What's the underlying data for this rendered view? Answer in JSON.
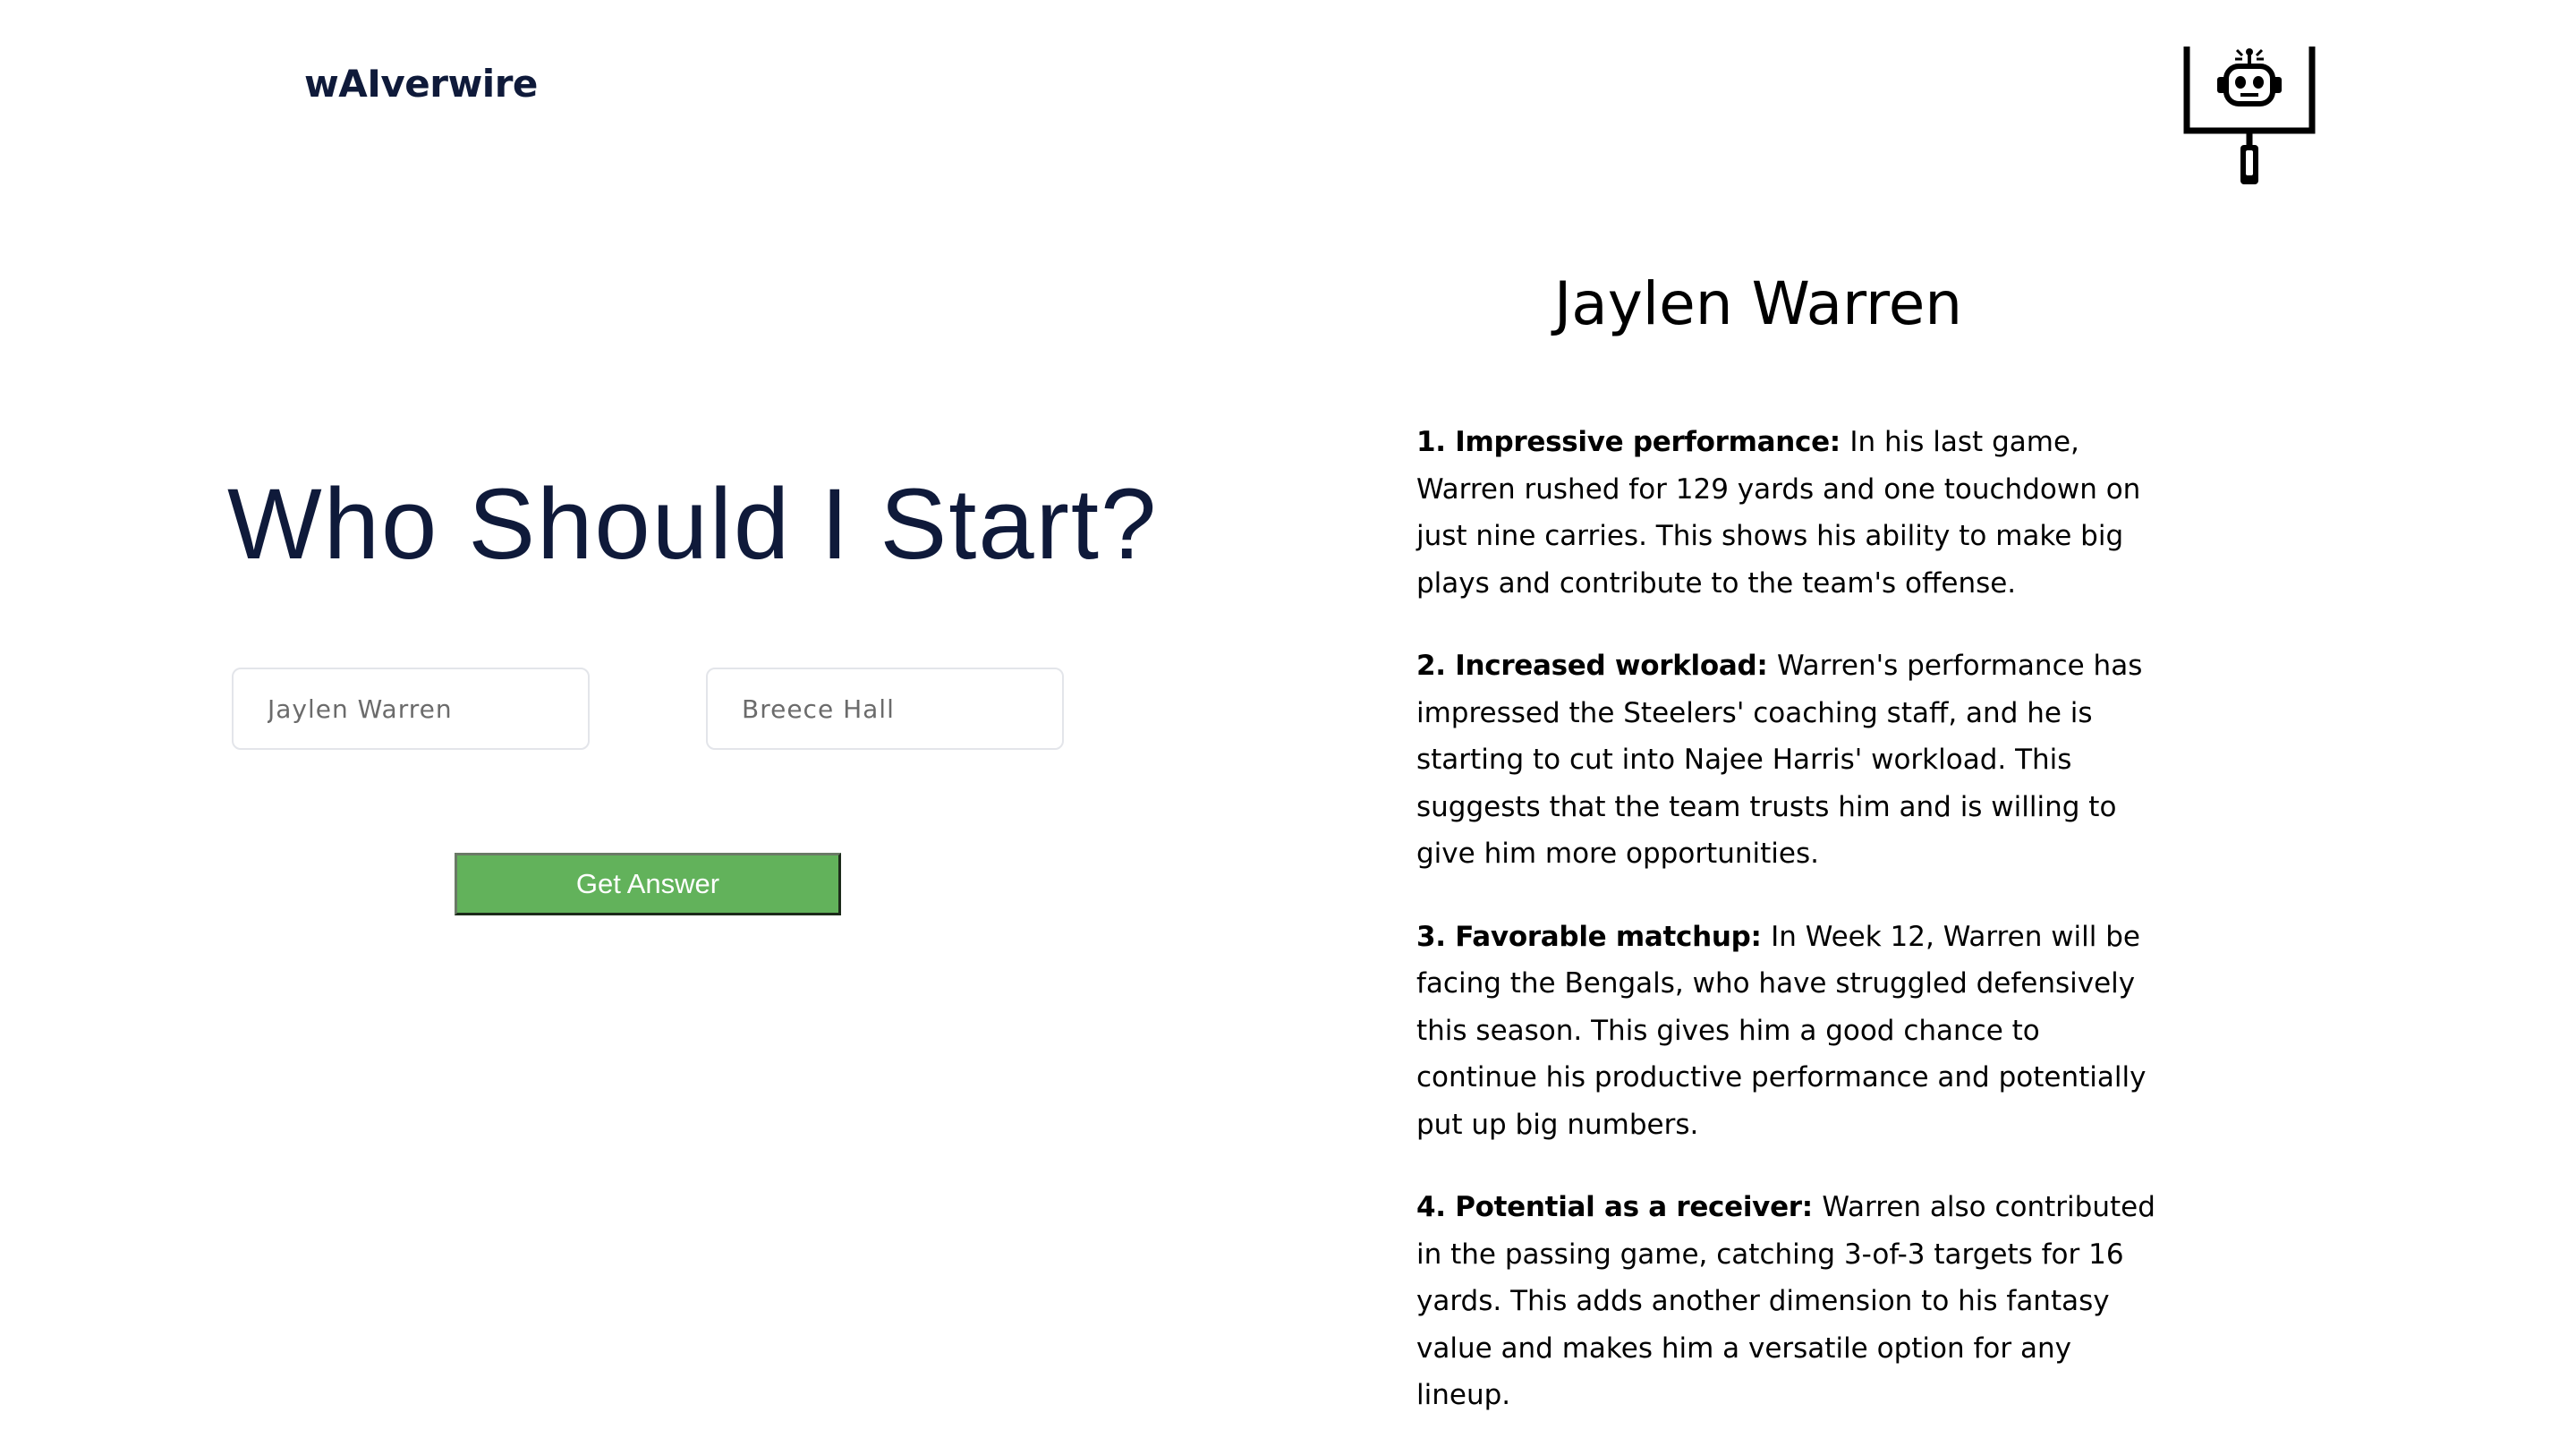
{
  "header": {
    "brand": "wAIverwire",
    "logo_icon": "goalpost-robot-icon"
  },
  "form": {
    "headline": "Who Should I Start?",
    "player1_placeholder": "Jaylen Warren",
    "player2_placeholder": "Breece Hall",
    "submit_label": "Get Answer"
  },
  "answer": {
    "title": "Jaylen Warren",
    "reasons": [
      {
        "label": "1. Impressive performance:",
        "text": "In his last game, Warren rushed for 129 yards and one touchdown on just nine carries. This shows his ability to make big plays and contribute to the team's offense."
      },
      {
        "label": "2. Increased workload:",
        "text": "Warren's performance has impressed the Steelers' coaching staff, and he is starting to cut into Najee Harris' workload. This suggests that the team trusts him and is willing to give him more opportunities."
      },
      {
        "label": "3. Favorable matchup:",
        "text": "In Week 12, Warren will be facing the Bengals, who have struggled defensively this season. This gives him a good chance to continue his productive performance and potentially put up big numbers."
      },
      {
        "label": "4. Potential as a receiver:",
        "text": "Warren also contributed in the passing game, catching 3-of-3 targets for 16 yards. This adds another dimension to his fantasy value and makes him a versatile option for any lineup."
      }
    ]
  },
  "colors": {
    "brand_text": "#0f1a3a",
    "button_bg": "#62b25b",
    "button_text": "#ffffff"
  }
}
